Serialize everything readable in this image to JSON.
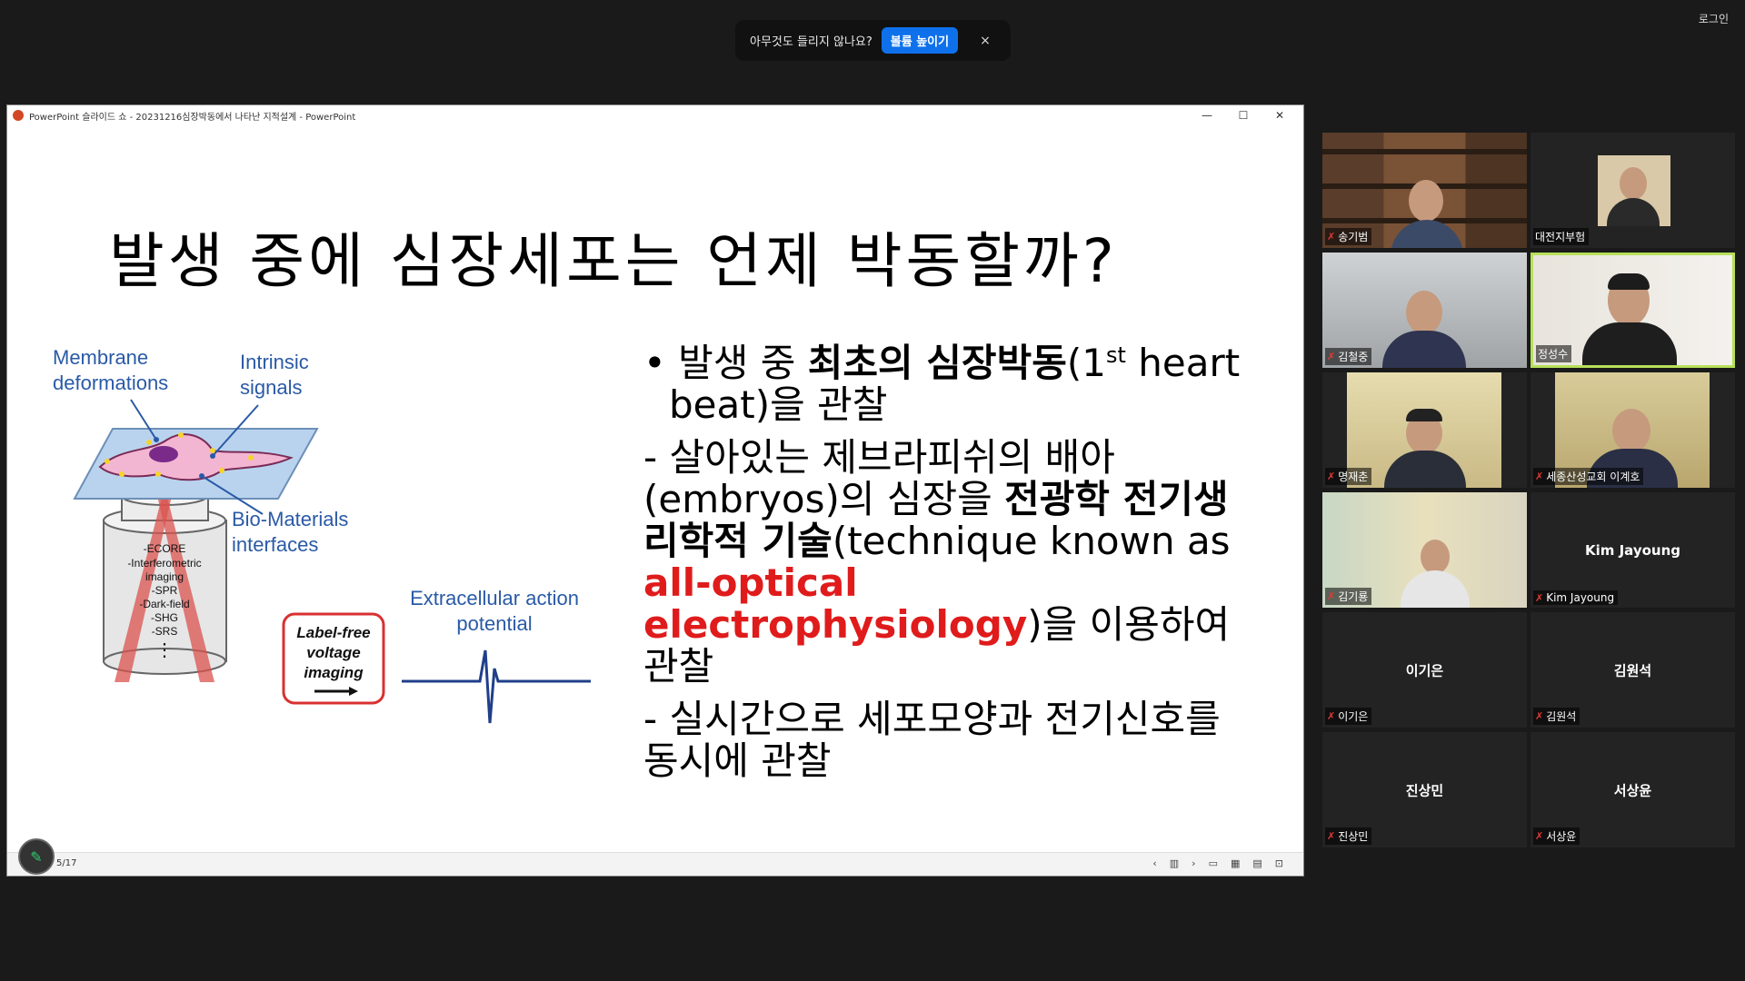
{
  "zoom": {
    "audio_message": "아무것도 들리지 않나요?",
    "audio_button": "볼륨 높이기",
    "audio_close": "×",
    "login_label": "로그인"
  },
  "ppt": {
    "window_title": "PowerPoint 슬라이드 쇼  -  20231216심장박동에서 나타난 지적설계 - PowerPoint",
    "minimize": "—",
    "maximize": "☐",
    "close": "✕",
    "slide_number": "5/17",
    "slide": {
      "title": "발생 중에 심장세포는 언제 박동할까?",
      "figure": {
        "membrane_label_1": "Membrane",
        "membrane_label_2": "deformations",
        "intrinsic_label_1": "Intrinsic",
        "intrinsic_label_2": "signals",
        "biomaterials_label_1": "Bio-Materials",
        "biomaterials_label_2": "interfaces",
        "methods": [
          "-ECORE",
          "-Interferometric",
          "imaging",
          "-SPR",
          "-Dark-field",
          "-SHG",
          "-SRS",
          "⋮"
        ],
        "labelfree_1": "Label-free",
        "labelfree_2": "voltage",
        "labelfree_3": "imaging",
        "extracellular_1": "Extracellular action",
        "extracellular_2": "potential"
      },
      "bullet1_prefix": "• 발생 중 ",
      "bullet1_bold": "최초의 심장박동",
      "bullet1_mid": "(1",
      "bullet1_sup": "st",
      "bullet1_suffix": " heart beat)을 관찰",
      "bullet2_a": "  - 살아있는 제브라피쉬의 배아 (embryos)의 심장을 ",
      "bullet2_bold": "전광학 전기생리학적 기술",
      "bullet2_b": "(technique known as ",
      "bullet2_red": "all-optical electrophysiology",
      "bullet2_c": ")을 이용하여 관찰",
      "bullet3": "    - 실시간으로 세포모양과 전기신호를 동시에 관찰"
    }
  },
  "participants": [
    {
      "name": "송기범",
      "display": "",
      "video": true,
      "muted": true
    },
    {
      "name": "대전지부험",
      "display": "",
      "video": true,
      "muted": false
    },
    {
      "name": "김철중",
      "display": "",
      "video": true,
      "muted": true
    },
    {
      "name": "정성수",
      "display": "",
      "video": true,
      "muted": false,
      "active": true
    },
    {
      "name": "명재춘",
      "display": "",
      "video": true,
      "muted": true
    },
    {
      "name": "세종산성교회 이계호",
      "display": "",
      "video": true,
      "muted": true
    },
    {
      "name": "김기룡",
      "display": "",
      "video": true,
      "muted": true
    },
    {
      "name": "Kim Jayoung",
      "display": "Kim Jayoung",
      "video": false,
      "muted": true
    },
    {
      "name": "이기은",
      "display": "이기은",
      "video": false,
      "muted": true
    },
    {
      "name": "김원석",
      "display": "김원석",
      "video": false,
      "muted": true
    },
    {
      "name": "진상민",
      "display": "진상민",
      "video": false,
      "muted": true
    },
    {
      "name": "서상윤",
      "display": "서상윤",
      "video": false,
      "muted": true
    }
  ]
}
